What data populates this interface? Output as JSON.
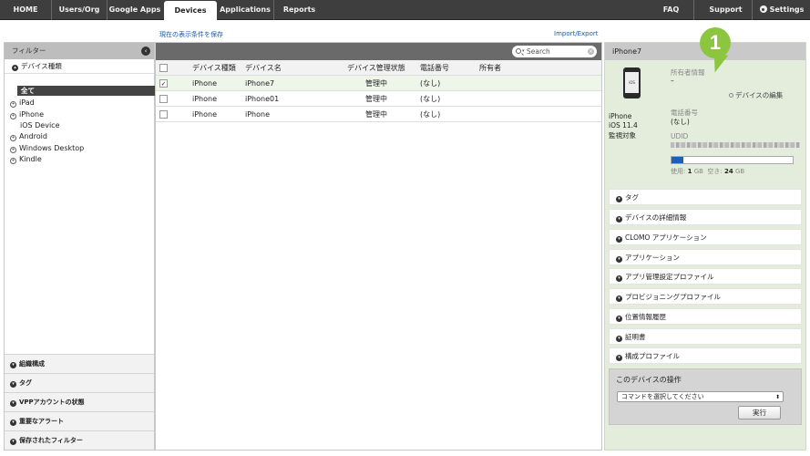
{
  "nav": {
    "tabs": [
      {
        "label": "HOME"
      },
      {
        "label": "Users/Org"
      },
      {
        "label": "Google Apps"
      },
      {
        "label": "Devices"
      },
      {
        "label": "Applications"
      },
      {
        "label": "Reports"
      }
    ],
    "active_tab": "Devices",
    "right": [
      {
        "label": "FAQ"
      },
      {
        "label": "Support"
      },
      {
        "label": "Settings"
      }
    ]
  },
  "links": {
    "save_view": "現在の表示条件を保存",
    "import_export": "Import/Export"
  },
  "filter": {
    "title": "フィルター",
    "device_type_heading": "デバイス種類",
    "all_label": "全て",
    "tree": [
      {
        "label": "iPad",
        "expandable": true
      },
      {
        "label": "iPhone",
        "expandable": true
      },
      {
        "label": "iOS Device",
        "expandable": false
      },
      {
        "label": "Android",
        "expandable": true
      },
      {
        "label": "Windows Desktop",
        "expandable": true
      },
      {
        "label": "Kindle",
        "expandable": true
      }
    ],
    "sections": [
      {
        "label": "組織構成"
      },
      {
        "label": "タグ"
      },
      {
        "label": "VPPアカウントの状態"
      },
      {
        "label": "重要なアラート"
      },
      {
        "label": "保存されたフィルター"
      }
    ]
  },
  "table": {
    "search_placeholder": "Search",
    "columns": [
      "デバイス種類",
      "デバイス名",
      "デバイス管理状態",
      "電話番号",
      "所有者"
    ],
    "rows": [
      {
        "type": "iPhone",
        "name": "iPhone7",
        "status": "管理中",
        "phone": "(なし)",
        "owner": "",
        "checked": true
      },
      {
        "type": "iPhone",
        "name": "iPhone01",
        "status": "管理中",
        "phone": "(なし)",
        "owner": "",
        "checked": false
      },
      {
        "type": "iPhone",
        "name": "iPhone",
        "status": "管理中",
        "phone": "(なし)",
        "owner": "",
        "checked": false
      }
    ]
  },
  "detail": {
    "title": "iPhone7",
    "phone_screen": "iOS",
    "model": "iPhone",
    "os": "iOS 11.4",
    "supervised": "監視対象",
    "owner_label": "所有者情報",
    "owner_value": "–",
    "edit_link": "デバイスの編集",
    "phone_label": "電話番号",
    "phone_value": "(なし)",
    "udid_label": "UDID",
    "storage": {
      "used_label": "使用:",
      "used_value": "1",
      "free_label": "空き:",
      "free_value": "24",
      "unit": "GB",
      "used_fraction": 0.04
    },
    "sections": [
      {
        "label": "タグ"
      },
      {
        "label": "デバイスの詳細情報"
      },
      {
        "label": "CLOMO アプリケーション"
      },
      {
        "label": "アプリケーション"
      },
      {
        "label": "アプリ管理設定プロファイル"
      },
      {
        "label": "プロビジョニングプロファイル"
      },
      {
        "label": "位置情報履歴"
      },
      {
        "label": "証明書"
      },
      {
        "label": "構成プロファイル"
      }
    ],
    "operations": {
      "title": "このデバイスの操作",
      "select_value": "コマンドを選択してください",
      "run_label": "実行"
    }
  },
  "callout": {
    "number": "1",
    "color": "#8cc63f"
  }
}
